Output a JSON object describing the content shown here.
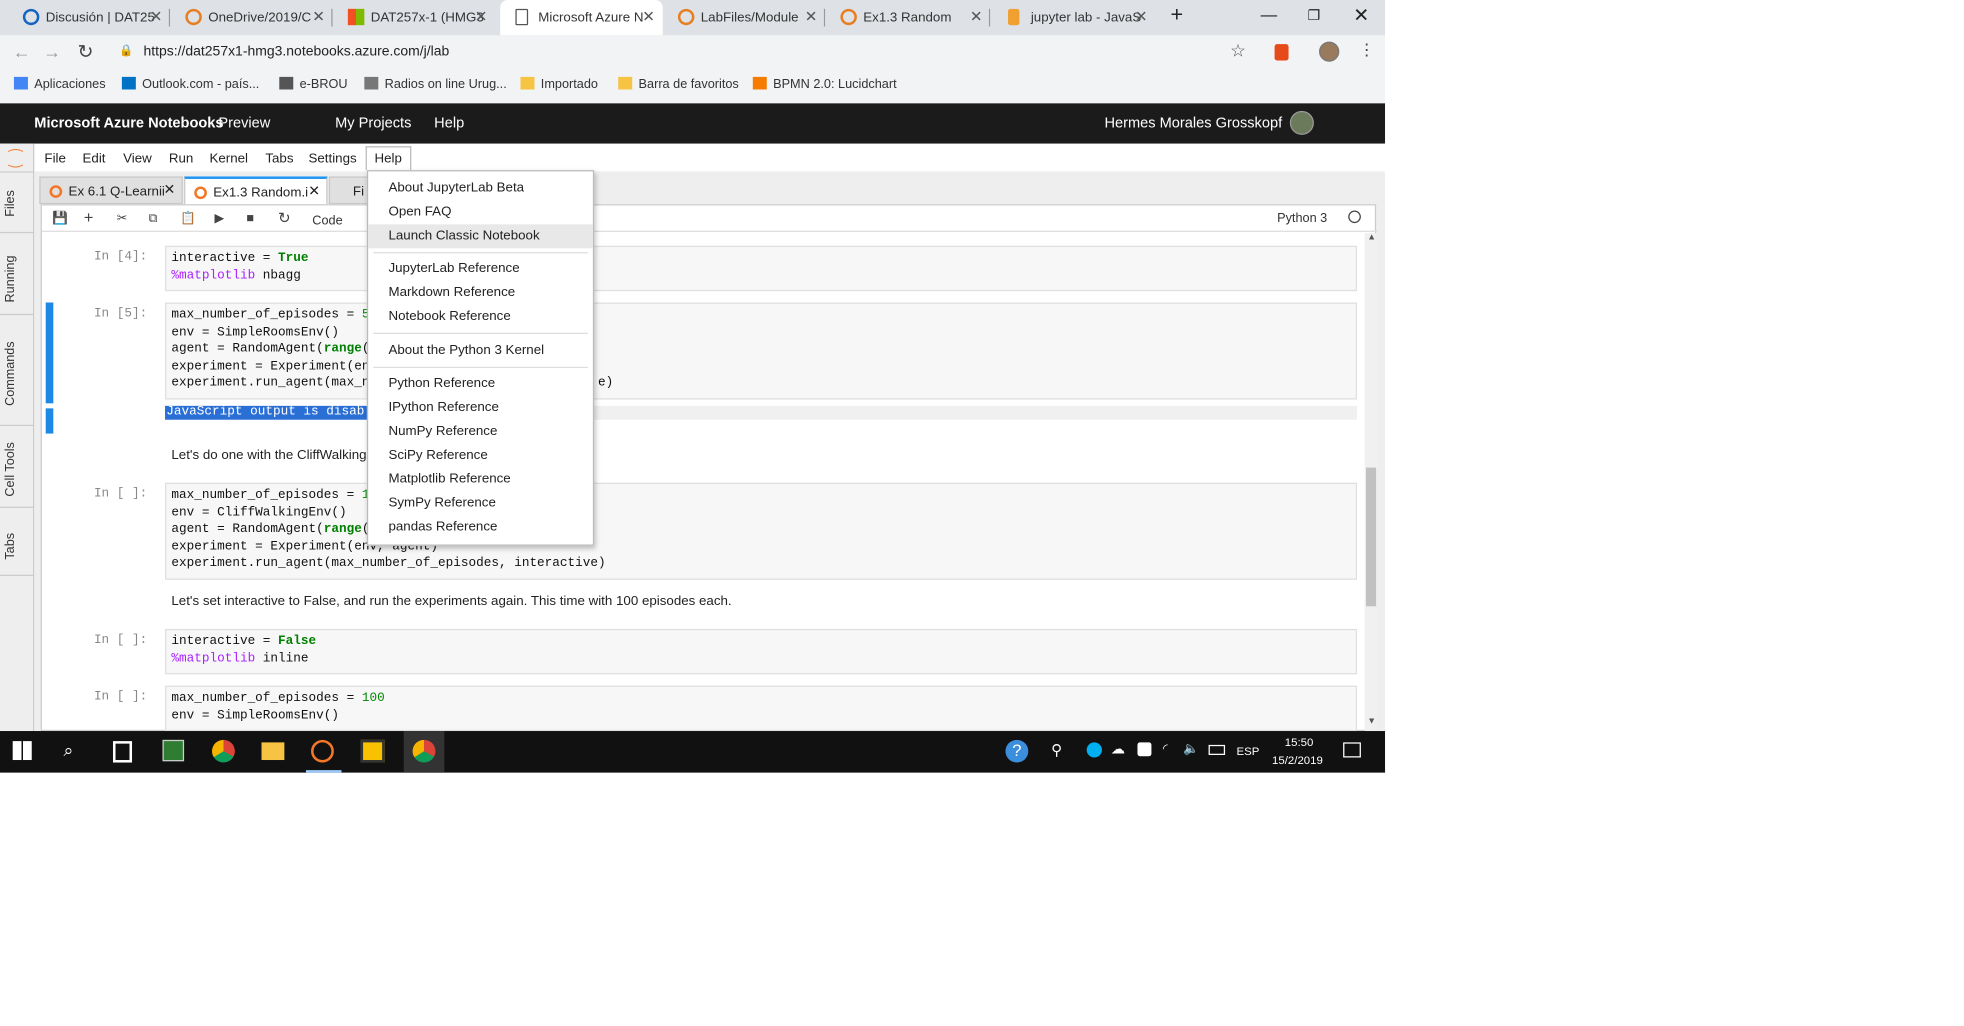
{
  "browser": {
    "tabs": [
      {
        "label": "Discusión | DAT25"
      },
      {
        "label": "OneDrive/2019/C"
      },
      {
        "label": "DAT257x-1 (HMG3"
      },
      {
        "label": "Microsoft Azure N"
      },
      {
        "label": "LabFiles/Module"
      },
      {
        "label": "Ex1.3 Random"
      },
      {
        "label": "jupyter lab - JavaS"
      }
    ],
    "new_tab_symbol": "+",
    "url": "https://dat257x1-hmg3.notebooks.azure.com/j/lab",
    "bookmarks": [
      {
        "label": "Aplicaciones",
        "color": "#4285f4"
      },
      {
        "label": "Outlook.com - país...",
        "color": "#0072c6"
      },
      {
        "label": "e-BROU",
        "color": "#555555"
      },
      {
        "label": "Radios on line Urug...",
        "color": "#777777"
      },
      {
        "label": "Importado",
        "color": "#f6c342"
      },
      {
        "label": "Barra de favoritos",
        "color": "#f6c342"
      },
      {
        "label": "BPMN 2.0: Lucidchart",
        "color": "#f57c00"
      }
    ]
  },
  "azure": {
    "brand": "Microsoft Azure Notebooks",
    "preview": "Preview",
    "nav": [
      "My Projects",
      "Help"
    ],
    "user": "Hermes Morales Grosskopf"
  },
  "jupyter": {
    "side_tabs": [
      "Files",
      "Running",
      "Commands",
      "Cell Tools",
      "Tabs"
    ],
    "menu": [
      "File",
      "Edit",
      "View",
      "Run",
      "Kernel",
      "Tabs",
      "Settings",
      "Help"
    ],
    "doc_tabs": [
      {
        "label": "Ex 6.1 Q-Learnii"
      },
      {
        "label": "Ex1.3 Random.i"
      },
      {
        "label": "Fi"
      }
    ],
    "cell_type": "Code",
    "kernel": "Python 3",
    "cells": [
      {
        "prompt": "In [4]:",
        "lines": [
          "interactive = True",
          "%matplotlib nbagg"
        ]
      },
      {
        "prompt": "In [5]:",
        "lines": [
          "max_number_of_episodes = 5",
          "env = SimpleRoomsEnv()",
          "agent = RandomAgent(range(",
          "experiment = Experiment(en",
          "experiment.run_agent(max_n                              e)"
        ]
      },
      {
        "output": "JavaScript output is disabl"
      },
      {
        "markdown": "Let's do one with the CliffWalking                                  episodes."
      },
      {
        "prompt": "In [ ]:",
        "lines": [
          "max_number_of_episodes = 1",
          "env = CliffWalkingEnv()",
          "agent = RandomAgent(range(",
          "experiment = Experiment(env, agent)",
          "experiment.run_agent(max_number_of_episodes, interactive)"
        ]
      },
      {
        "markdown": "Let's set interactive to False, and run the experiments again. This time with 100 episodes each."
      },
      {
        "prompt": "In [ ]:",
        "lines": [
          "interactive = False",
          "%matplotlib inline"
        ]
      },
      {
        "prompt": "In [ ]:",
        "lines": [
          "max_number_of_episodes = 100",
          "env = SimpleRoomsEnv()"
        ]
      }
    ],
    "help_menu": [
      [
        "About JupyterLab Beta",
        "Open FAQ",
        "Launch Classic Notebook"
      ],
      [
        "JupyterLab Reference",
        "Markdown Reference",
        "Notebook Reference"
      ],
      [
        "About the Python 3 Kernel"
      ],
      [
        "Python Reference",
        "IPython Reference",
        "NumPy Reference",
        "SciPy Reference",
        "Matplotlib Reference",
        "SymPy Reference",
        "pandas Reference"
      ]
    ],
    "highlighted_item": "Launch Classic Notebook"
  },
  "taskbar": {
    "lang": "ESP",
    "time": "15:50",
    "date": "15/2/2019"
  }
}
